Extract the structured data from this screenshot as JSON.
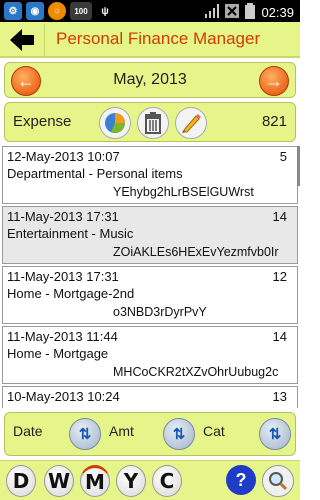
{
  "status_bar": {
    "time": "02:39",
    "icons": [
      "settings-notification-icon",
      "camera-notification-icon",
      "app-notification-icon",
      "battery-100-icon",
      "usb-icon",
      "signal-icon",
      "wifi-off-icon",
      "battery-icon"
    ],
    "battery_label": "100"
  },
  "app": {
    "title": "Personal Finance Manager",
    "accent": "#d23b00",
    "panel_color": "#e6f58a"
  },
  "month_nav": {
    "label": "May, 2013",
    "prev_glyph": "←",
    "next_glyph": "→"
  },
  "summary": {
    "label": "Expense",
    "total": "821"
  },
  "transactions": [
    {
      "date": "12-May-2013 10:07",
      "amount": "5",
      "category": "Departmental - Personal items",
      "note": "YEhybg2hLrBSElGUWrst"
    },
    {
      "date": "11-May-2013 17:31",
      "amount": "14",
      "category": "Entertainment - Music",
      "note": "ZOiAKLEs6HExEvYezmfvb0Ir"
    },
    {
      "date": "11-May-2013 17:31",
      "amount": "12",
      "category": "Home - Mortgage-2nd",
      "note": "o3NBD3rDyrPvY"
    },
    {
      "date": "11-May-2013 11:44",
      "amount": "14",
      "category": "Home - Mortgage",
      "note": "MHCoCKR2tXZvOhrUubug2c"
    },
    {
      "date": "10-May-2013 10:24",
      "amount": "13",
      "category": "",
      "note": ""
    }
  ],
  "sort": {
    "date_label": "Date",
    "amount_label": "Amt",
    "category_label": "Cat"
  },
  "bottom_nav": {
    "letters": [
      "D",
      "W",
      "M",
      "Y",
      "C"
    ],
    "active": "M",
    "help_glyph": "?"
  }
}
